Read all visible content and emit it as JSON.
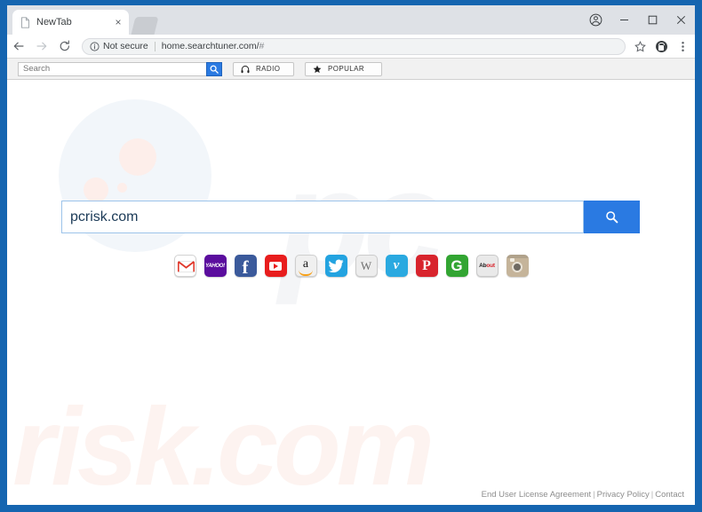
{
  "window": {
    "frame_color": "#1565b0",
    "controls": [
      {
        "name": "profile-avatar",
        "label": ""
      },
      {
        "name": "minimize",
        "label": ""
      },
      {
        "name": "maximize",
        "label": ""
      },
      {
        "name": "close",
        "label": ""
      }
    ]
  },
  "tabs": [
    {
      "title": "NewTab",
      "close_label": "×",
      "active": true
    }
  ],
  "omnibox": {
    "security_label": "Not secure",
    "url": "home.searchtuner.com/",
    "url_hash": "#",
    "back_icon": "back-arrow-icon",
    "forward_icon": "forward-arrow-icon",
    "reload_icon": "reload-icon",
    "bookmark_icon": "star-icon",
    "extension_icon": "extension-icon",
    "menu_icon": "three-dot-menu-icon"
  },
  "ext_toolbar": {
    "search_placeholder": "Search",
    "search_value": "",
    "search_button_icon": "search-icon",
    "pills": [
      {
        "id": "radio",
        "label": "RADIO",
        "icon": "headphones-icon"
      },
      {
        "id": "popular",
        "label": "POPULAR",
        "icon": "star-icon"
      }
    ]
  },
  "page": {
    "watermark_pc": "pc",
    "watermark_risk": "risk.com",
    "search": {
      "value": "pcrisk.com",
      "placeholder": "",
      "button_icon": "search-icon",
      "button_color": "#2a7ae2",
      "border_color": "#9cc3ea"
    },
    "shortcuts": [
      {
        "id": "gmail",
        "name": "Gmail",
        "text": "",
        "bg": "#ffffff"
      },
      {
        "id": "yahoo",
        "name": "Yahoo",
        "text": "YAHOO!",
        "bg": "#5b0d9e"
      },
      {
        "id": "facebook",
        "name": "Facebook",
        "text": "f",
        "bg": "#3b5a9b"
      },
      {
        "id": "youtube",
        "name": "YouTube",
        "text": "",
        "bg": "#e81d1d"
      },
      {
        "id": "amazon",
        "name": "Amazon",
        "text": "a",
        "bg": "#f0f0f0"
      },
      {
        "id": "twitter",
        "name": "Twitter",
        "text": "",
        "bg": "#23a3e0"
      },
      {
        "id": "wikipedia",
        "name": "Wikipedia",
        "text": "W",
        "bg": "#ededed"
      },
      {
        "id": "vimeo",
        "name": "Vimeo",
        "text": "v",
        "bg": "#2aa9e0"
      },
      {
        "id": "pinterest",
        "name": "Pinterest",
        "text": "P",
        "bg": "#d8242d"
      },
      {
        "id": "groupon",
        "name": "Groupon",
        "text": "G",
        "bg": "#32a532"
      },
      {
        "id": "about",
        "name": "About",
        "text": "About",
        "bg": "#e9e9e9"
      },
      {
        "id": "instagram",
        "name": "Instagram",
        "text": "",
        "bg": "#c5b49a"
      }
    ],
    "footer": {
      "eula": "End User License Agreement",
      "privacy": "Privacy Policy",
      "contact": "Contact",
      "separator": "|"
    }
  }
}
